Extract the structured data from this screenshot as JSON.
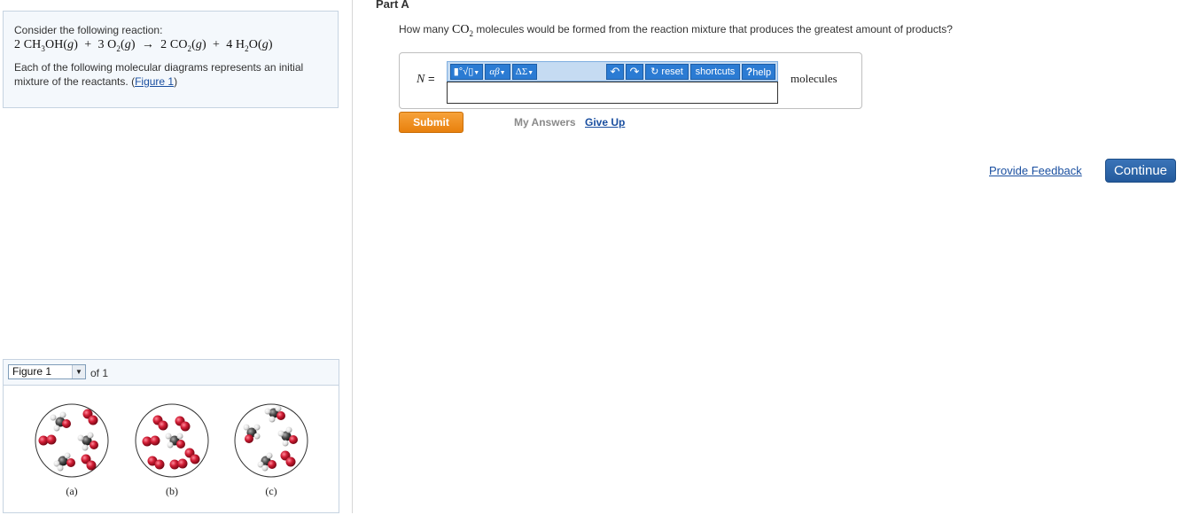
{
  "problem": {
    "intro": "Consider the following reaction:",
    "equation": {
      "c1": "2",
      "r1": "CH",
      "r1s": "3",
      "r1b": "OH(",
      "r1g": "g",
      "c2": "3",
      "r2": "O",
      "r2s": "2",
      "r2g": "g",
      "arrow": "→",
      "c3": "2",
      "p1": "CO",
      "p1s": "2",
      "p1g": "g",
      "c4": "4",
      "p2": "H",
      "p2s": "2",
      "p2b": "O(",
      "p2g": "g"
    },
    "description": "Each of the following molecular diagrams represents an initial mixture of the reactants.",
    "figure_link_open": "(",
    "figure_link": "Figure 1",
    "figure_link_close": ")"
  },
  "figure_panel": {
    "selected": "Figure 1",
    "of_text": "of 1",
    "labels": [
      "(a)",
      "(b)",
      "(c)"
    ]
  },
  "part": {
    "title": "Part A",
    "question_pre": "How many",
    "question_chem": "CO",
    "question_chem_sub": "2",
    "question_post": "molecules would be formed from the reaction mixture that produces the greatest amount of products?",
    "variable": "N",
    "equals": "=",
    "unit": "molecules",
    "answer_value": ""
  },
  "toolbar": {
    "templates": "▮°√▯",
    "greek": "αβ",
    "symbols": "ΔΣ",
    "reset": "reset",
    "shortcuts": "shortcuts",
    "help": "help",
    "help_glyph": "?"
  },
  "actions": {
    "submit": "Submit",
    "my_answers": "My Answers",
    "give_up": "Give Up",
    "feedback": "Provide Feedback",
    "continue": "Continue"
  },
  "colors": {
    "accent_blue": "#2b7bd3",
    "submit_orange": "#f0921f",
    "continue_blue": "#2d66ab",
    "atom_oxygen": "#d01c34",
    "atom_carbon": "#4a4a4a",
    "atom_hydrogen": "#e8e8e8"
  }
}
